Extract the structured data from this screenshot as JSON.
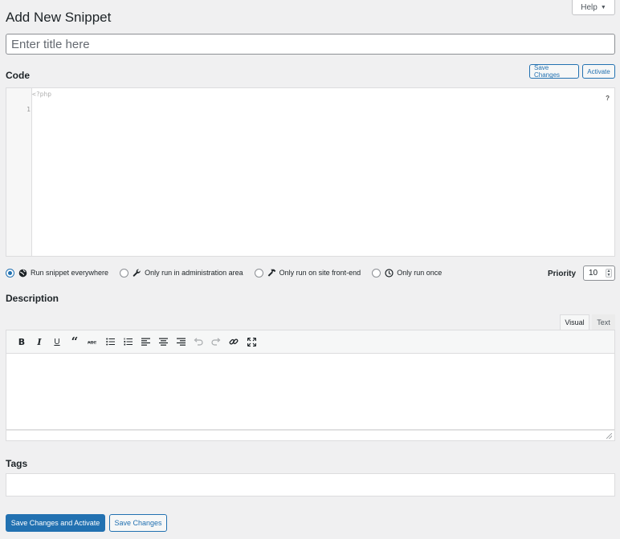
{
  "header": {
    "title": "Add New Snippet",
    "help_label": "Help"
  },
  "title_field": {
    "placeholder": "Enter title here",
    "value": ""
  },
  "code_section": {
    "label": "Code",
    "save_label": "Save Changes",
    "activate_label": "Activate",
    "editor": {
      "php_tag": "<?php",
      "line_numbers": [
        "1"
      ],
      "help_marker": "?"
    }
  },
  "scope": {
    "options": [
      {
        "label": "Run snippet everywhere",
        "icon": "globe-icon",
        "checked": true
      },
      {
        "label": "Only run in administration area",
        "icon": "wrench-icon",
        "checked": false
      },
      {
        "label": "Only run on site front-end",
        "icon": "hammer-icon",
        "checked": false
      },
      {
        "label": "Only run once",
        "icon": "clock-icon",
        "checked": false
      }
    ],
    "priority_label": "Priority",
    "priority_value": "10"
  },
  "description": {
    "label": "Description",
    "tabs": [
      "Visual",
      "Text"
    ],
    "active_tab": "Visual",
    "toolbar": [
      "bold-icon",
      "italic-icon",
      "underline-icon",
      "blockquote-icon",
      "strikethrough-icon",
      "bullet-list-icon",
      "numbered-list-icon",
      "align-left-icon",
      "align-center-icon",
      "align-right-icon",
      "undo-icon",
      "redo-icon",
      "link-icon",
      "fullscreen-icon"
    ],
    "content": ""
  },
  "tags": {
    "label": "Tags",
    "value": ""
  },
  "footer": {
    "primary_label": "Save Changes and Activate",
    "secondary_label": "Save Changes"
  },
  "colors": {
    "accent": "#2271b1",
    "background": "#f0f0f1",
    "border": "#dcdcde"
  }
}
